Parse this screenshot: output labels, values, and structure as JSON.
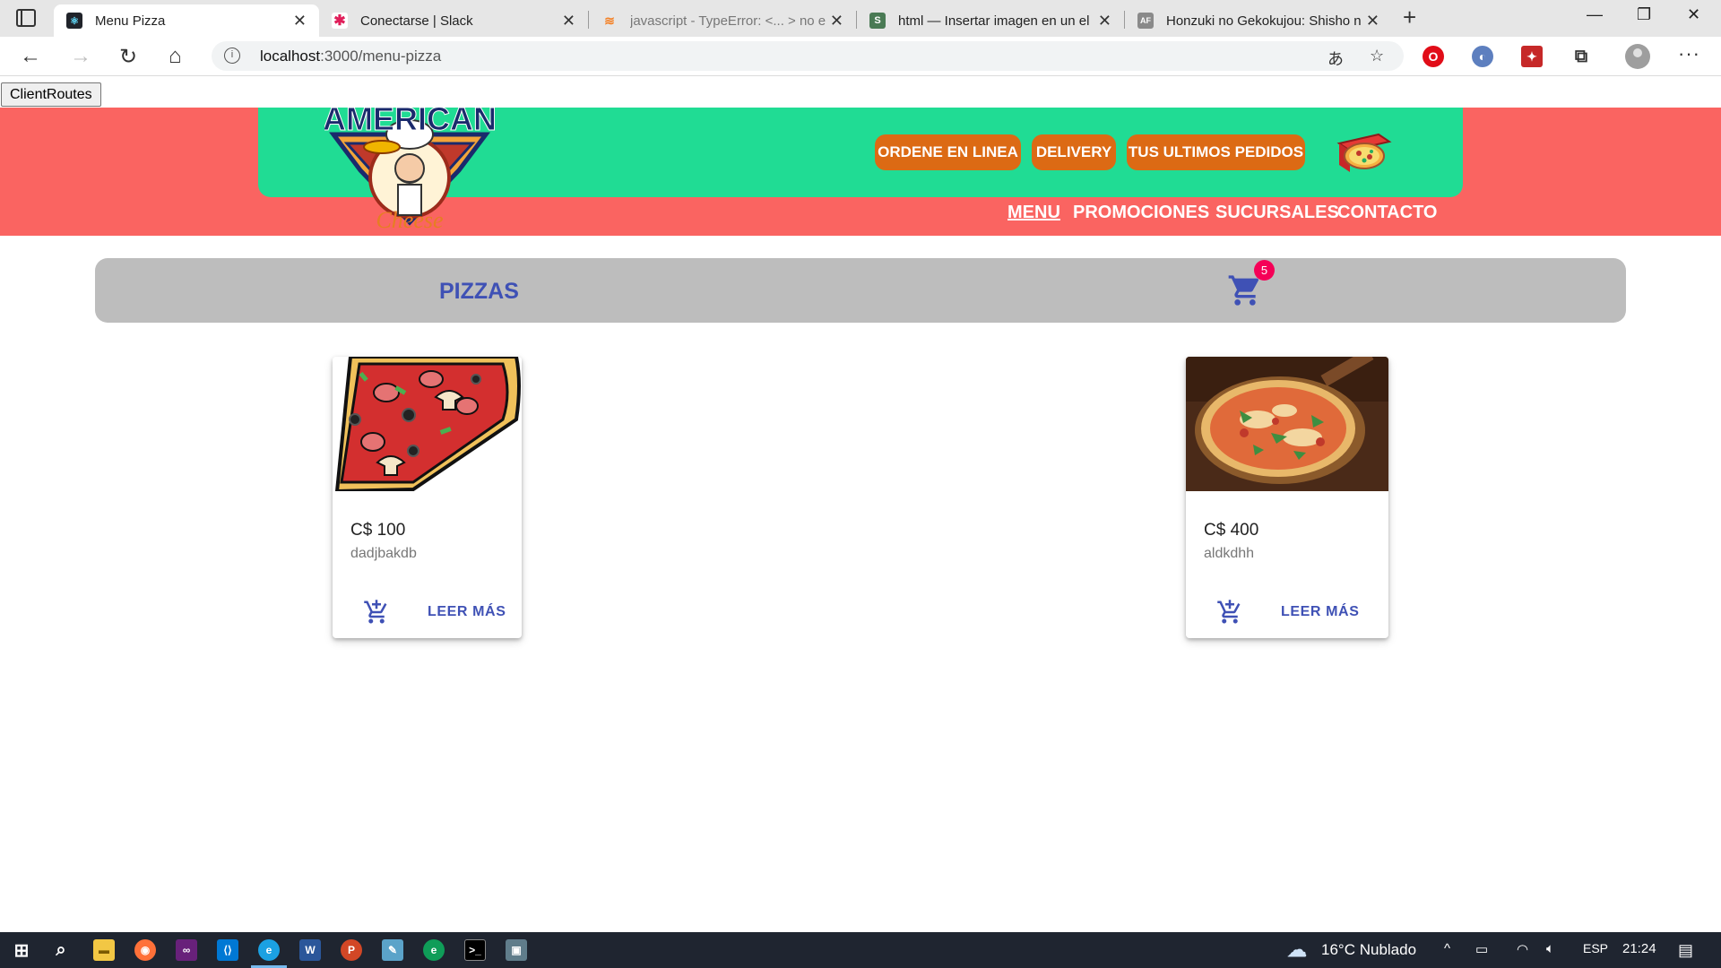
{
  "browser": {
    "tabs": [
      {
        "title": "Menu Pizza",
        "favicon_color": "#20232a"
      },
      {
        "title": "Conectarse | Slack",
        "favicon_color": "#e01e5a"
      },
      {
        "title": "javascript - TypeError: <... > no e",
        "favicon_color": "#f48024"
      },
      {
        "title": "html — Insertar imagen en un el",
        "favicon_color": "#4a7a54"
      },
      {
        "title": "Honzuki no Gekokujou: Shisho n",
        "favicon_color": "#8a8a8a"
      }
    ],
    "url_host": "localhost",
    "url_path": ":3000/menu-pizza",
    "icons": {
      "back": "arrow-left-icon",
      "forward": "arrow-right-icon",
      "reload": "reload-icon",
      "home": "home-icon",
      "info": "info-icon",
      "read_aloud": "read-aloud-icon",
      "favorites": "add-favorite-icon",
      "extensions": "puzzle-icon"
    }
  },
  "page": {
    "client_routes_label": "ClientRoutes",
    "header": {
      "logo_text_top": "AMERICAN",
      "logo_text_bottom": "Cheese",
      "order_buttons": [
        "ORDENE EN LINEA",
        "DELIVERY",
        "TUS ULTIMOS PEDIDOS"
      ],
      "nav_links": [
        "MENU",
        "PROMOCIONES",
        "SUCURSALES",
        "CONTACTO"
      ],
      "active_nav": "MENU",
      "colors": {
        "hero": "#fa6461",
        "green": "#20dc94",
        "button": "#dc6a14"
      }
    },
    "toolbar": {
      "title": "PIZZAS",
      "cart_count": "5",
      "accent": "#3f51b5",
      "badge_color": "#f50057"
    },
    "products": [
      {
        "price": "C$ 100",
        "description": "dadjbakdb",
        "more_label": "LEER MÁS",
        "image": "pizza-slice-cartoon"
      },
      {
        "price": "C$ 400",
        "description": "aldkdhh",
        "more_label": "LEER MÁS",
        "image": "pizza-photo"
      }
    ]
  },
  "taskbar": {
    "weather": "16°C  Nublado",
    "language": "ESP",
    "time": "21:24"
  }
}
